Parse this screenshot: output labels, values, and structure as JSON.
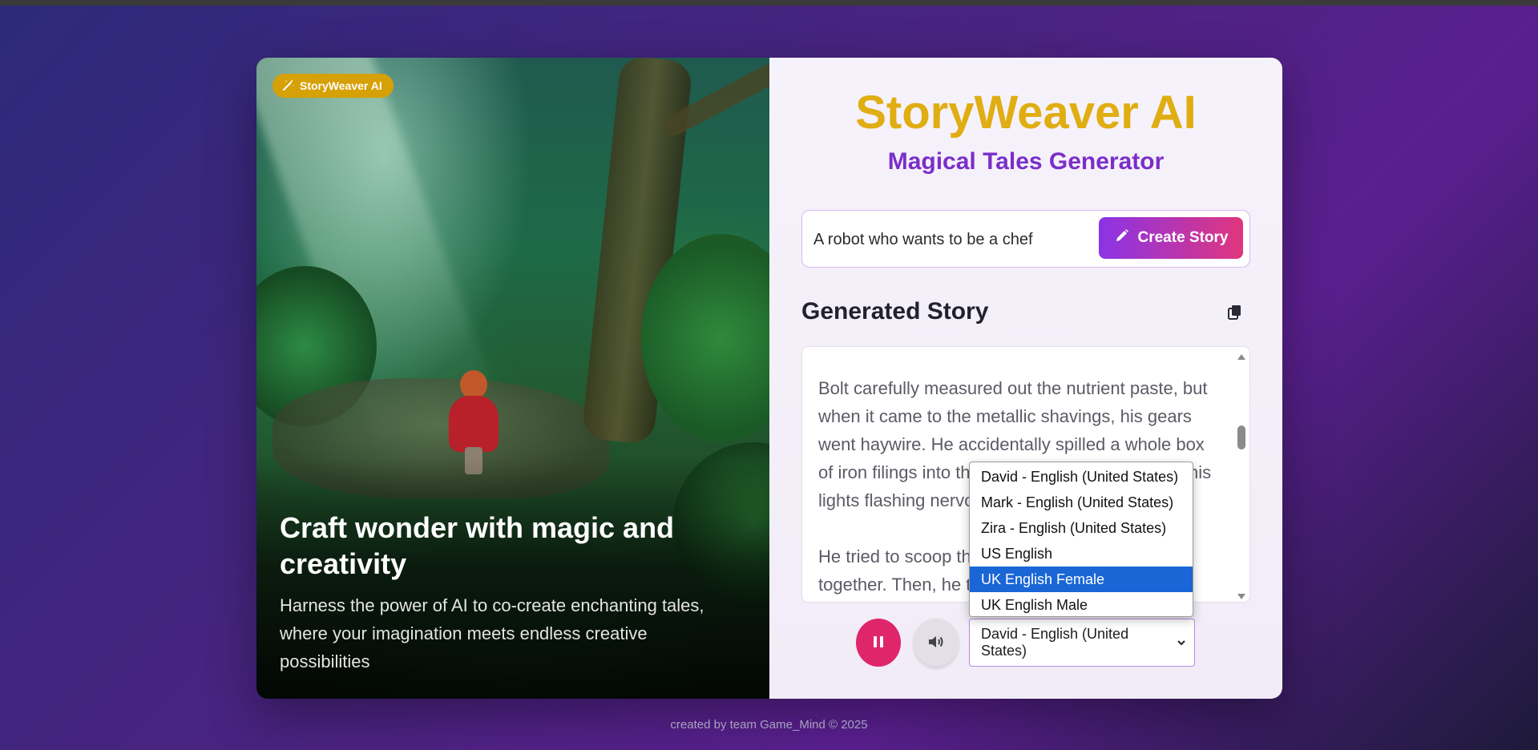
{
  "hero": {
    "badge": "StoryWeaver AI",
    "title": "Craft wonder with magic and creativity",
    "subtitle": "Harness the power of AI to co-create enchanting tales, where your imagination meets endless creative possibilities"
  },
  "app": {
    "title": "StoryWeaver AI",
    "subtitle": "Magical Tales Generator"
  },
  "prompt": {
    "value": "A robot who wants to be a chef",
    "button_label": "Create Story"
  },
  "story": {
    "heading": "Generated Story",
    "paragraphs": [
      "Bolt carefully measured out the nutrient paste, but when it came to the metallic shavings, his gears went haywire. He accidentally spilled a whole box of iron filings into the bowl! \"Oops,\" he beeped, his lights flashing nervously.",
      "He tried to scoop them out, but they all clumped together. Then, he tried"
    ]
  },
  "voice": {
    "selected": "David - English (United States)",
    "options": [
      "David - English (United States)",
      "Mark - English (United States)",
      "Zira - English (United States)",
      "US English",
      "UK English Female",
      "UK English Male"
    ],
    "highlighted_index": 4
  },
  "footer": {
    "text": "created by team Game_Mind © 2025"
  },
  "colors": {
    "accent_gold": "#e0ad12",
    "accent_purple": "#7b2ec9",
    "pause_button": "#e0266a",
    "highlight_blue": "#1a66d6"
  },
  "icons": {
    "badge": "magic-wand-icon",
    "create": "pencil-icon",
    "copy": "copy-icon",
    "pause": "pause-icon",
    "speaker": "speaker-icon"
  }
}
